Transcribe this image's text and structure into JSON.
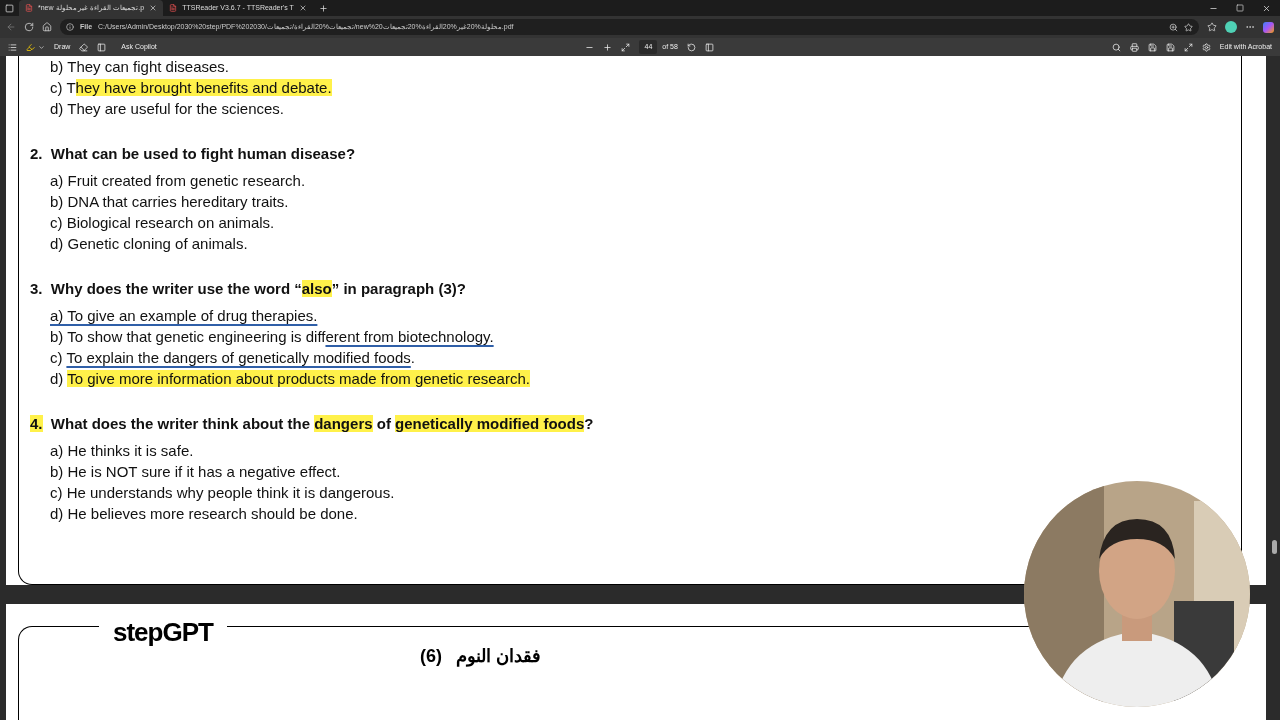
{
  "browser": {
    "tabs": [
      {
        "title": "*new تجميعات القراءة غير محلولة.p",
        "selected": true
      },
      {
        "title": "TTSReader V3.6.7 - TTSReader's T",
        "selected": false
      }
    ],
    "url_prefix": "File",
    "url": "C:/Users/Admin/Desktop/2030%20step/PDF%202030/تجميعات%20القراءة/تجميعات/new%20محلولة%20غير%20القراءة%20تجميعات.pdf"
  },
  "pdf_toolbar": {
    "draw": "Draw",
    "copilot": "Ask Copilot",
    "page": "44",
    "page_total": "of 58",
    "acrobat": "Edit with Acrobat"
  },
  "page": {
    "items": [
      {
        "options": [
          [
            {
              "text": "b) They can fight diseases."
            }
          ],
          [
            {
              "text": "c) T"
            },
            {
              "text": "hey have brought benefits and debate.",
              "highlight": true
            }
          ],
          [
            {
              "text": "d) They are useful for the sciences."
            }
          ]
        ]
      },
      {
        "question": [
          {
            "text": "2.  What can be used to fight human disease?"
          }
        ],
        "options": [
          [
            {
              "text": "a) Fruit created from genetic research."
            }
          ],
          [
            {
              "text": "b) DNA that carries hereditary traits."
            }
          ],
          [
            {
              "text": "c) Biological research on animals."
            }
          ],
          [
            {
              "text": "d) Genetic cloning of animals."
            }
          ]
        ]
      },
      {
        "question": [
          {
            "text": "3.  Why does the writer use the word “"
          },
          {
            "text": "also",
            "highlight": true
          },
          {
            "text": "” in paragraph (3)?"
          }
        ],
        "options": [
          [
            {
              "text": "a) To give an example of drug therapies.",
              "struck": true
            }
          ],
          [
            {
              "text": "b) To show that genetic engineering is diff"
            },
            {
              "text": "erent from biotechnology.",
              "struck": true
            }
          ],
          [
            {
              "text": "c) "
            },
            {
              "text": "To explain the dangers of genetically modified foods",
              "struck": true
            },
            {
              "text": "."
            }
          ],
          [
            {
              "text": "d) "
            },
            {
              "text": "To give more information about products made from genetic research.",
              "highlight": true
            }
          ]
        ]
      },
      {
        "question": [
          {
            "text": "4.",
            "highlight": true
          },
          {
            "text": "  What does the writer think about the "
          },
          {
            "text": "dangers",
            "highlight": true
          },
          {
            "text": " of "
          },
          {
            "text": "genetically modified foods",
            "highlight": true
          },
          {
            "text": "?"
          }
        ],
        "options": [
          [
            {
              "text": "a) He thinks it is safe."
            }
          ],
          [
            {
              "text": "b) He is NOT sure if it has a negative effect."
            }
          ],
          [
            {
              "text": "c) He understands why people think it is dangerous."
            }
          ],
          [
            {
              "text": "d) He believes more research should be done."
            }
          ]
        ]
      }
    ]
  },
  "next_page": {
    "logo": "stepGPT",
    "number": "(6)",
    "title": "فقدان النوم"
  }
}
